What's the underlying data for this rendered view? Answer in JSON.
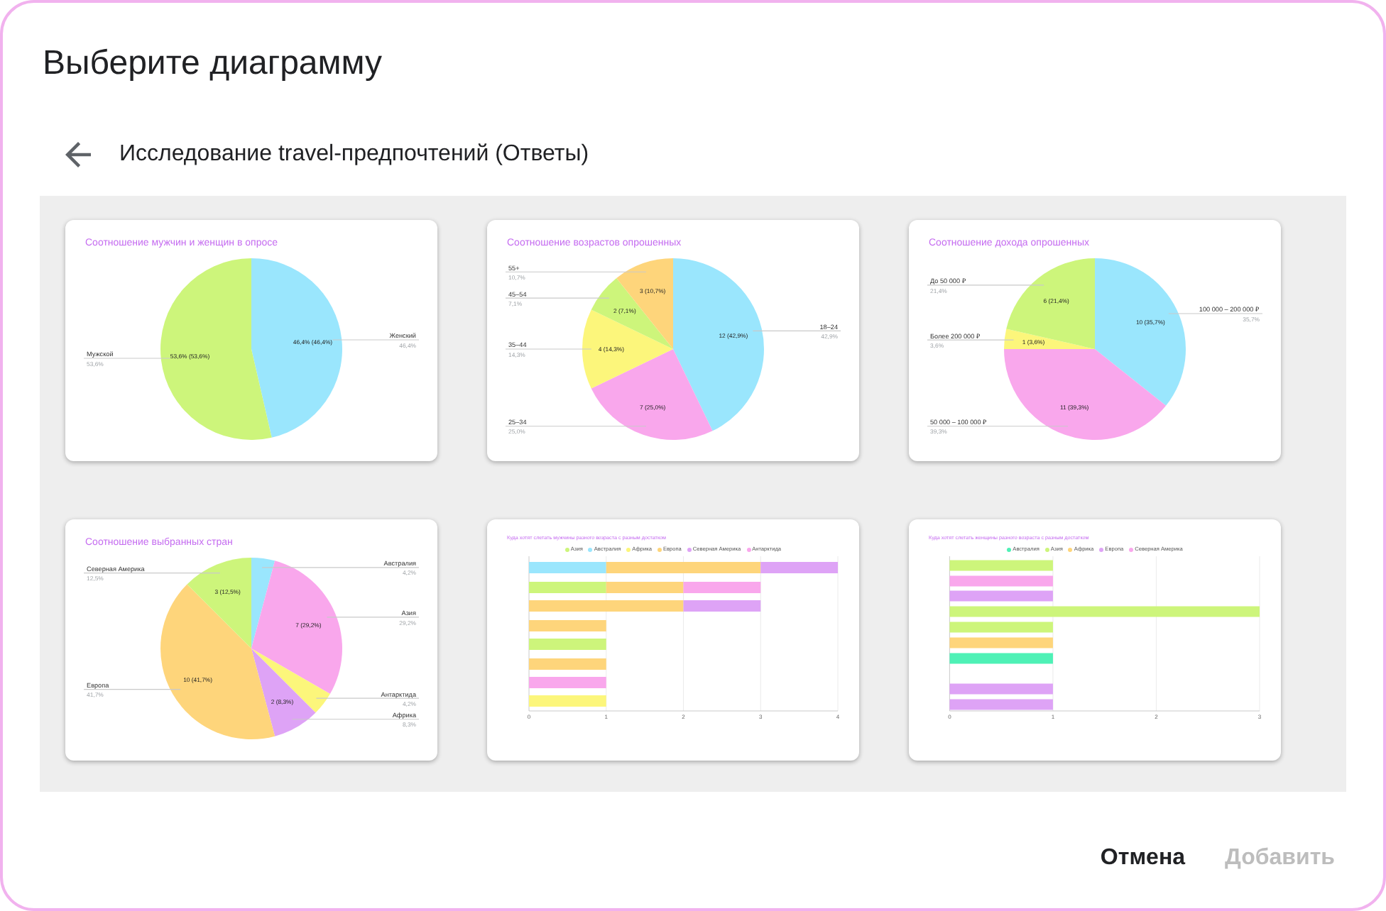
{
  "dialog": {
    "title": "Выберите диаграмму"
  },
  "source": {
    "title": "Исследование travel-предпочтений (Ответы)"
  },
  "charts": [
    {
      "kind": "pie",
      "chart_data": {
        "type": "pie",
        "title": "Соотношение мужчин и женщин в опросе",
        "categories": [
          "Женский",
          "Мужской"
        ],
        "values": [
          46.4,
          53.6
        ],
        "colors": [
          "#9ae6fd",
          "#cdf57b"
        ],
        "value_labels": [
          "46,4% (46,4%)",
          "53,6% (53,6%)"
        ],
        "annotations": [
          "46,4%",
          "53,6%"
        ]
      }
    },
    {
      "kind": "pie",
      "chart_data": {
        "type": "pie",
        "title": "Соотношение возрастов опрошенных",
        "categories": [
          "18–24",
          "25–34",
          "35–44",
          "45–54",
          "55+"
        ],
        "values": [
          12,
          7,
          4,
          2,
          3
        ],
        "colors": [
          "#9ae6fd",
          "#f9a7ec",
          "#fcf67b",
          "#cdf57b",
          "#fed57b"
        ],
        "value_labels": [
          "12 (42,9%)",
          "7 (25,0%)",
          "4 (14,3%)",
          "2 (7,1%)",
          "3 (10,7%)"
        ],
        "annotations": [
          "42,9%",
          "25,0%",
          "14,3%",
          "7,1%",
          "10,7%"
        ]
      }
    },
    {
      "kind": "pie",
      "chart_data": {
        "type": "pie",
        "title": "Соотношение дохода опрошенных",
        "categories": [
          "100 000 – 200 000 ₽",
          "50 000 – 100 000 ₽",
          "Более 200 000 ₽",
          "До 50 000 ₽"
        ],
        "values": [
          10,
          11,
          1,
          6
        ],
        "colors": [
          "#9ae6fd",
          "#f9a7ec",
          "#fcf67b",
          "#cdf57b"
        ],
        "value_labels": [
          "10 (35,7%)",
          "11 (39,3%)",
          "1 (3,6%)",
          "6 (21,4%)"
        ],
        "annotations": [
          "35,7%",
          "39,3%",
          "3,6%",
          "21,4%"
        ]
      }
    },
    {
      "kind": "pie",
      "chart_data": {
        "type": "pie",
        "title": "Соотношение выбранных стран",
        "categories": [
          "Австралия",
          "Азия",
          "Антарктида",
          "Африка",
          "Европа",
          "Северная Америка"
        ],
        "values": [
          1,
          7,
          1,
          2,
          10,
          3
        ],
        "colors": [
          "#9ae6fd",
          "#f9a7ec",
          "#fcf67b",
          "#dea3f6",
          "#fed57b",
          "#cdf57b"
        ],
        "value_labels": [
          null,
          "7 (29,2%)",
          null,
          "2 (8,3%)",
          "10 (41,7%)",
          "3 (12,5%)"
        ],
        "annotations": [
          "4,2%",
          "29,2%",
          "4,2%",
          "8,3%",
          "41,7%",
          "12,5%"
        ]
      }
    },
    {
      "kind": "bar",
      "title": "Куда хотят слетать мужчины разного возраста с разным достатком",
      "legend": [
        {
          "label": "Азия",
          "color": "#cdf57b"
        },
        {
          "label": "Австралия",
          "color": "#9ae6fd"
        },
        {
          "label": "Африка",
          "color": "#fcf67b"
        },
        {
          "label": "Европа",
          "color": "#fed57b"
        },
        {
          "label": "Северная Америка",
          "color": "#dea3f6"
        },
        {
          "label": "Антарктида",
          "color": "#f9a7ec"
        }
      ],
      "x_ticks": [
        "0",
        "1",
        "2",
        "3",
        "4"
      ]
    },
    {
      "kind": "bar",
      "title": "Куда хотят слетать женщины разного возраста с разным достатком",
      "legend": [
        {
          "label": "Австралия",
          "color": "#4ef1b6"
        },
        {
          "label": "Азия",
          "color": "#cdf57b"
        },
        {
          "label": "Африка",
          "color": "#fed57b"
        },
        {
          "label": "Европа",
          "color": "#dea3f6"
        },
        {
          "label": "Северная Америка",
          "color": "#f9a7ec"
        }
      ],
      "x_ticks": [
        "0",
        "1",
        "2",
        "3"
      ]
    }
  ],
  "buttons": [
    {
      "label": "Отмена",
      "disabled": false
    },
    {
      "label": "Добавить",
      "disabled": true
    }
  ]
}
